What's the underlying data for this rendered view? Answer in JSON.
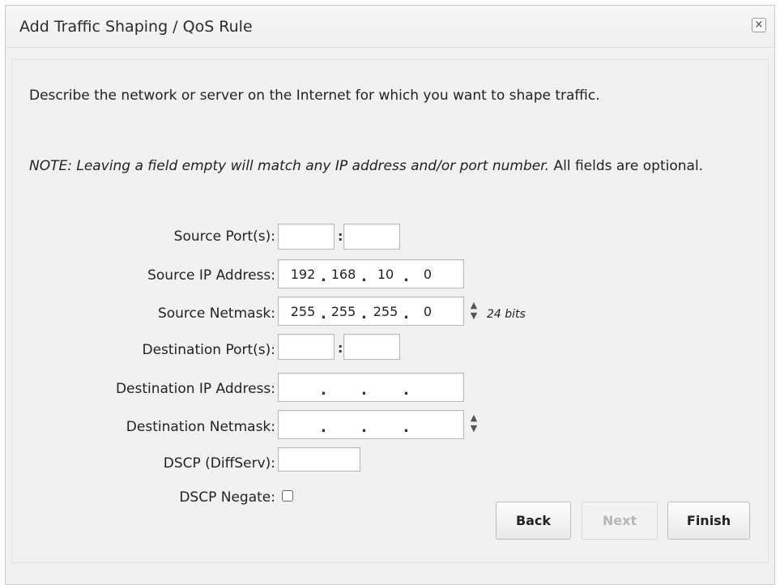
{
  "dialog": {
    "title": "Add Traffic Shaping / QoS Rule",
    "close_glyph": "×"
  },
  "content": {
    "description": "Describe the network or server on the Internet for which you want to shape traffic.",
    "note_italic": "NOTE: Leaving a field empty will match any IP address and/or port number.",
    "note_plain": " All fields are optional."
  },
  "fields": {
    "source_ports": {
      "label": "Source Port(s):",
      "start": "",
      "end": ""
    },
    "source_ip": {
      "label": "Source IP Address:",
      "octets": [
        "192",
        "168",
        "10",
        "0"
      ]
    },
    "source_netmask": {
      "label": "Source Netmask:",
      "octets": [
        "255",
        "255",
        "255",
        "0"
      ],
      "bits_text": "24 bits"
    },
    "destination_ports": {
      "label": "Destination Port(s):",
      "start": "",
      "end": ""
    },
    "destination_ip": {
      "label": "Destination IP Address:",
      "octets": [
        "",
        "",
        "",
        ""
      ]
    },
    "destination_netmask": {
      "label": "Destination Netmask:",
      "octets": [
        "",
        "",
        "",
        ""
      ]
    },
    "dscp": {
      "label": "DSCP (DiffServ):",
      "value": ""
    },
    "dscp_negate": {
      "label": "DSCP Negate:",
      "checked": false
    }
  },
  "buttons": {
    "back": "Back",
    "next": "Next",
    "finish": "Finish"
  },
  "icons": {
    "close": "close-icon",
    "spinner": "spinner-arrows-icon",
    "checkbox": "checkbox-unchecked"
  }
}
